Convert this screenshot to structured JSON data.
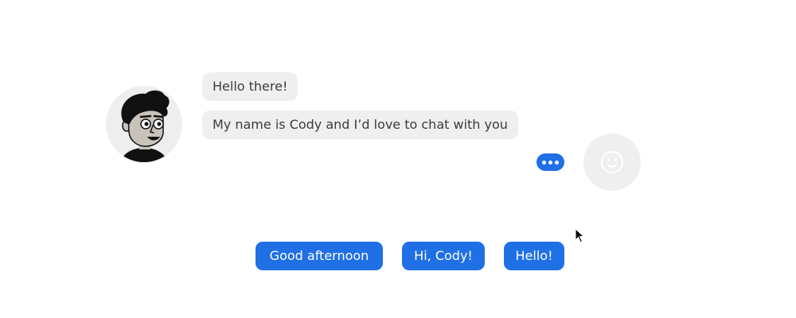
{
  "colors": {
    "accent": "#1f6fe5",
    "bubble_bg": "#efefef",
    "bubble_text": "#3c3c3c"
  },
  "bot": {
    "avatar_icon": "cartoon-man-avatar",
    "messages": [
      {
        "text": "Hello there!"
      },
      {
        "text": "My name is Cody and I’d love to chat with you"
      }
    ]
  },
  "typing_indicator": {
    "icon": "ellipsis-icon"
  },
  "user": {
    "avatar_icon": "smiley-face-icon"
  },
  "quick_replies": [
    {
      "label": "Good afternoon"
    },
    {
      "label": "Hi, Cody!"
    },
    {
      "label": "Hello!"
    }
  ]
}
